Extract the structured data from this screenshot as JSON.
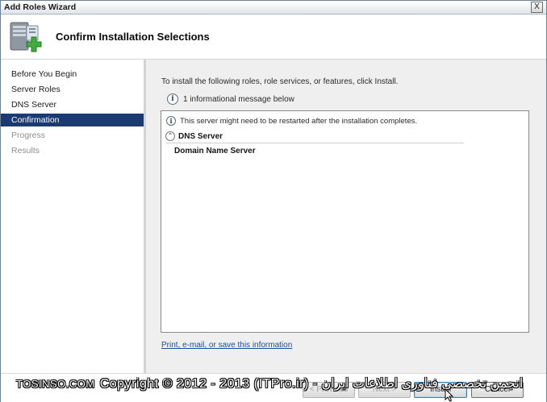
{
  "window": {
    "title": "Add Roles Wizard",
    "close_label": "X"
  },
  "header": {
    "title": "Confirm Installation Selections",
    "icon": "server-roles-add-icon"
  },
  "sidebar": {
    "items": [
      {
        "label": "Before You Begin",
        "state": "normal"
      },
      {
        "label": "Server Roles",
        "state": "normal"
      },
      {
        "label": "DNS Server",
        "state": "normal"
      },
      {
        "label": "Confirmation",
        "state": "active"
      },
      {
        "label": "Progress",
        "state": "disabled"
      },
      {
        "label": "Results",
        "state": "disabled"
      }
    ]
  },
  "content": {
    "intro": "To install the following roles, role services, or features, click Install.",
    "info_message": "1 informational message below",
    "list": {
      "message": "This server might need to be restarted after the installation completes.",
      "section_title": "DNS Server",
      "section_detail": "Domain Name Server"
    },
    "link": "Print, e-mail, or save this information"
  },
  "buttons": {
    "previous": "< Previous",
    "next": "Next >",
    "install": "Install",
    "cancel": "Cancel"
  },
  "watermark": {
    "brand": "TOSINSO.COM",
    "text": "Copyright © 2012 - 2013 (ITPro.ir) - انجمن تخصصی فناوری اطلاعات ایران"
  },
  "colors": {
    "active_nav": "#1c3a72",
    "link": "#1a4fa0",
    "content_bg": "#efefef"
  }
}
